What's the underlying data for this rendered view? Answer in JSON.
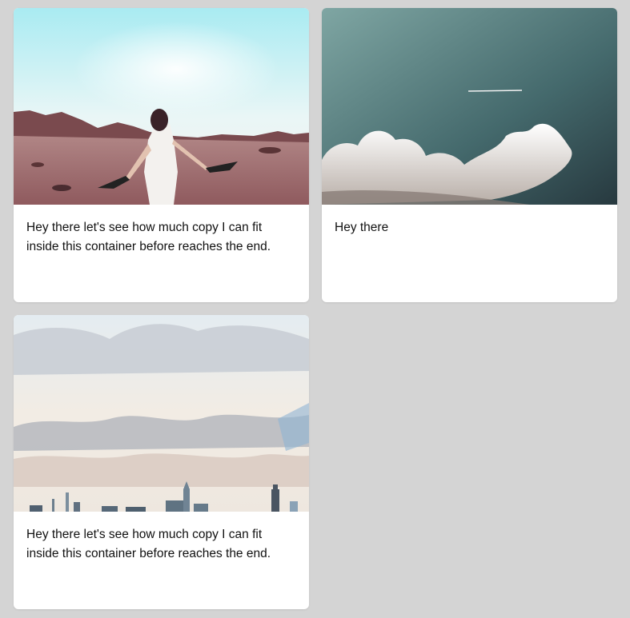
{
  "cards": [
    {
      "image_name": "desert-woman-photo",
      "copy": "Hey there let's see how much copy I can fit inside this container before reaches the end."
    },
    {
      "image_name": "cloud-sky-photo",
      "copy": "Hey there"
    },
    {
      "image_name": "city-skyline-clouds-photo",
      "copy": "Hey there let's see how much copy I can fit inside this container before reaches the end."
    }
  ]
}
